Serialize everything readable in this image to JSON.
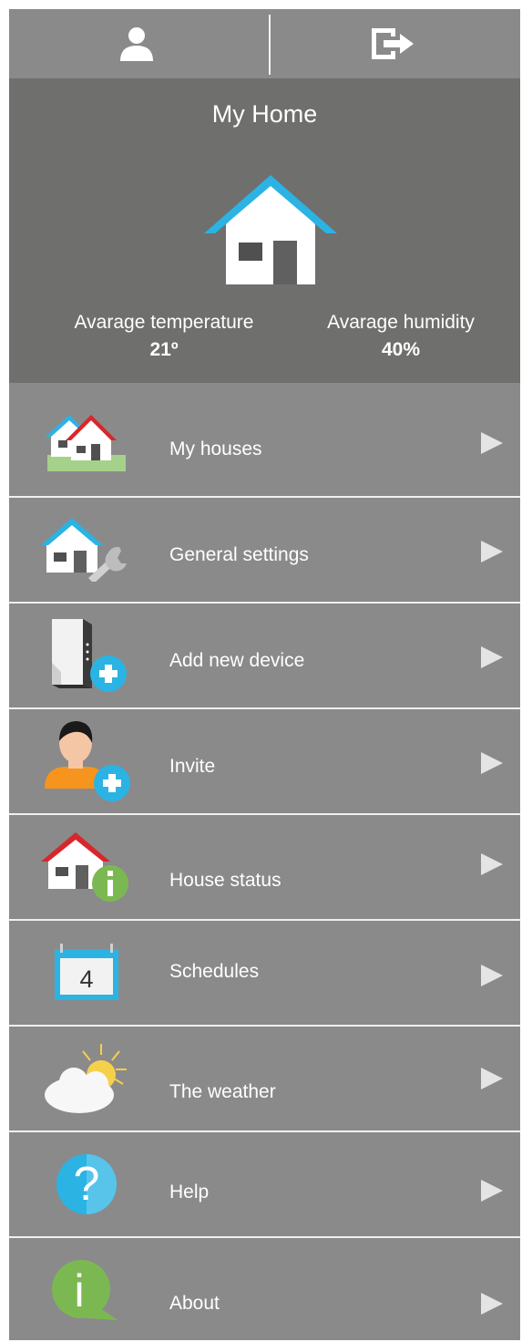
{
  "topbar": {
    "profile_icon": "user-icon",
    "logout_icon": "logout-icon"
  },
  "header": {
    "title": "My Home",
    "house_icon": "home-icon",
    "temperature_label": "Avarage temperature",
    "temperature_value": "21º",
    "humidity_label": "Avarage humidity",
    "humidity_value": "40%"
  },
  "menu": {
    "items": [
      {
        "label": "My houses",
        "icon": "houses-icon"
      },
      {
        "label": "General settings",
        "icon": "house-wrench-icon"
      },
      {
        "label": "Add new device",
        "icon": "device-add-icon"
      },
      {
        "label": "Invite",
        "icon": "person-add-icon"
      },
      {
        "label": "House status",
        "icon": "house-info-icon"
      },
      {
        "label": "Schedules",
        "icon": "calendar-icon",
        "calendar_day": "4"
      },
      {
        "label": "The weather",
        "icon": "weather-icon"
      },
      {
        "label": "Help",
        "icon": "help-icon",
        "glyph": "?"
      },
      {
        "label": "About",
        "icon": "about-icon",
        "glyph": "i"
      }
    ]
  },
  "colors": {
    "background": "#8a8a8a",
    "header_background": "#6f6f6d",
    "roof_blue": "#2bb3e4",
    "roof_red": "#d9262b",
    "accent_green": "#7cb852",
    "accent_orange": "#f7941d",
    "arrow": "#e4e4e4"
  }
}
